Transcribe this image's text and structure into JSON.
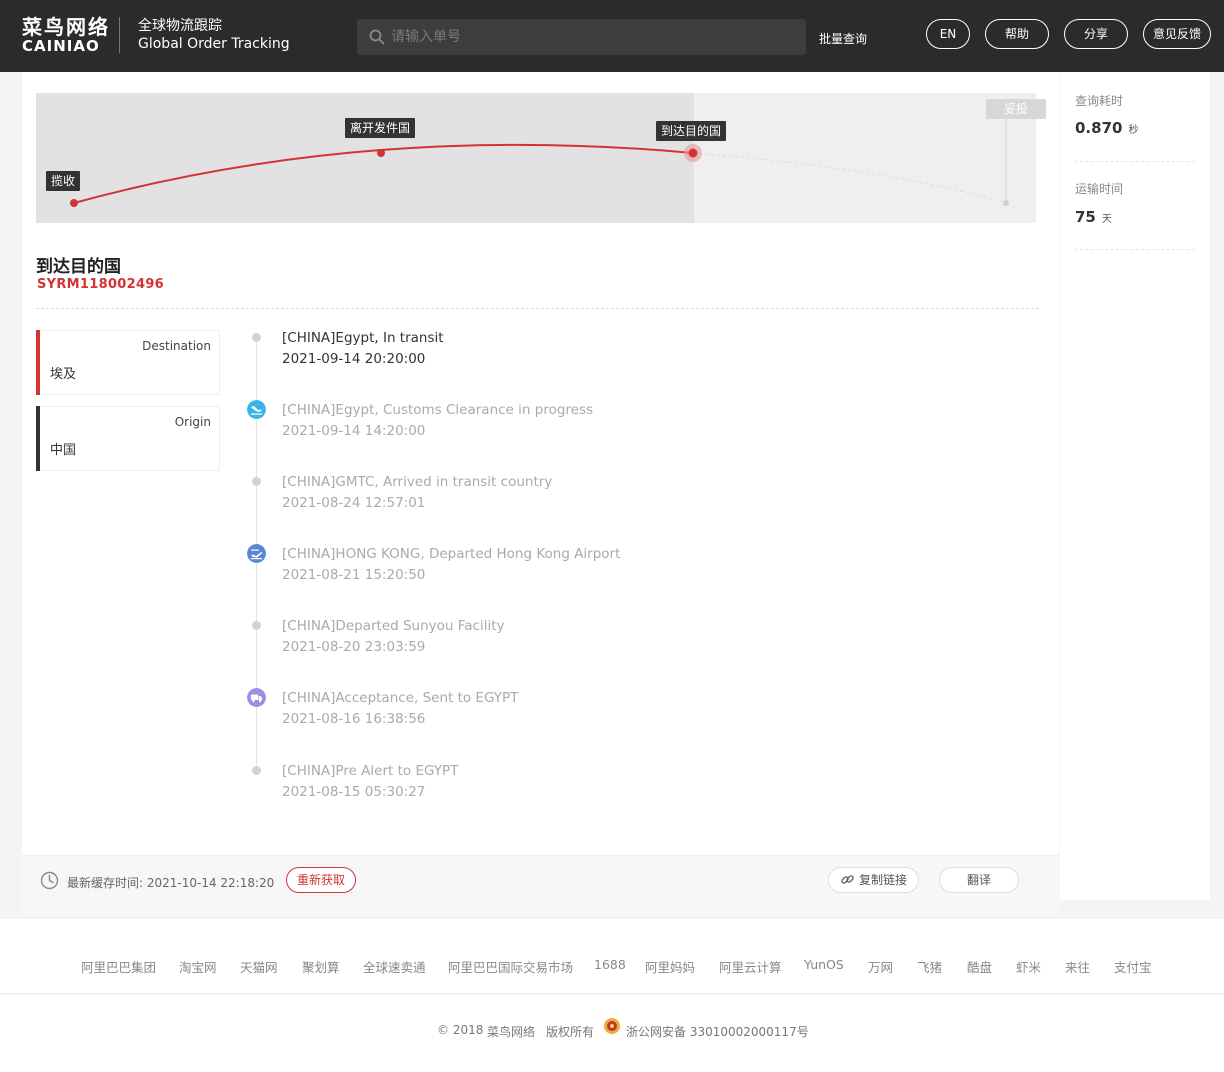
{
  "header": {
    "logo_cn": "菜鸟网络",
    "logo_en": "CAINIAO",
    "title_cn": "全球物流跟踪",
    "title_en": "Global Order Tracking",
    "search_placeholder": "请输入单号",
    "batch_query": "批量查询",
    "buttons": {
      "lang": "EN",
      "help": "帮助",
      "share": "分享",
      "feedback": "意见反馈"
    }
  },
  "progress": {
    "stages": [
      "揽收",
      "离开发件国",
      "到达目的国",
      "妥投"
    ],
    "current_stage": "到达目的国"
  },
  "shipment": {
    "status_title": "到达目的国",
    "tracking_number": "SYRM118002496",
    "destination": {
      "label": "Destination",
      "value": "埃及"
    },
    "origin": {
      "label": "Origin",
      "value": "中国"
    }
  },
  "events": [
    {
      "desc": "[CHINA]Egypt, In transit",
      "time": "2021-09-14 20:20:00",
      "icon": "dot"
    },
    {
      "desc": "[CHINA]Egypt, Customs Clearance in progress",
      "time": "2021-09-14 14:20:00",
      "icon": "plane-landing-icon"
    },
    {
      "desc": "[CHINA]GMTC, Arrived in transit country",
      "time": "2021-08-24 12:57:01",
      "icon": "dot"
    },
    {
      "desc": "[CHINA]HONG KONG, Departed Hong Kong Airport",
      "time": "2021-08-21 15:20:50",
      "icon": "plane-departure-icon"
    },
    {
      "desc": "[CHINA]Departed Sunyou Facility",
      "time": "2021-08-20 23:03:59",
      "icon": "dot"
    },
    {
      "desc": "[CHINA]Acceptance, Sent to EGYPT",
      "time": "2021-08-16 16:38:56",
      "icon": "truck-icon"
    },
    {
      "desc": "[CHINA]Pre Alert to EGYPT",
      "time": "2021-08-15 05:30:27",
      "icon": "dot"
    }
  ],
  "footer_bar": {
    "cache_label": "最新缓存时间: 2021-10-14 22:18:20",
    "refresh": "重新获取",
    "copy_link": "复制链接",
    "translate": "翻译"
  },
  "stats": {
    "query_time_label": "查询耗时",
    "query_time_value": "0.870",
    "query_time_unit": "秒",
    "transit_label": "运输时间",
    "transit_value": "75",
    "transit_unit": "天"
  },
  "footer_links": [
    "阿里巴巴集团",
    "淘宝网",
    "天猫网",
    "聚划算",
    "全球速卖通",
    "阿里巴巴国际交易市场",
    "1688",
    "阿里妈妈",
    "阿里云计算",
    "YunOS",
    "万网",
    "飞猪",
    "酷盘",
    "虾米",
    "来往",
    "支付宝"
  ],
  "copyright": {
    "year": "© 2018",
    "company": "菜鸟网络",
    "rights": "版权所有",
    "icp": "浙公网安备 33010002000117号"
  },
  "colors": {
    "header_bg": "#2b2b2b",
    "accent_red": "#d23434"
  }
}
